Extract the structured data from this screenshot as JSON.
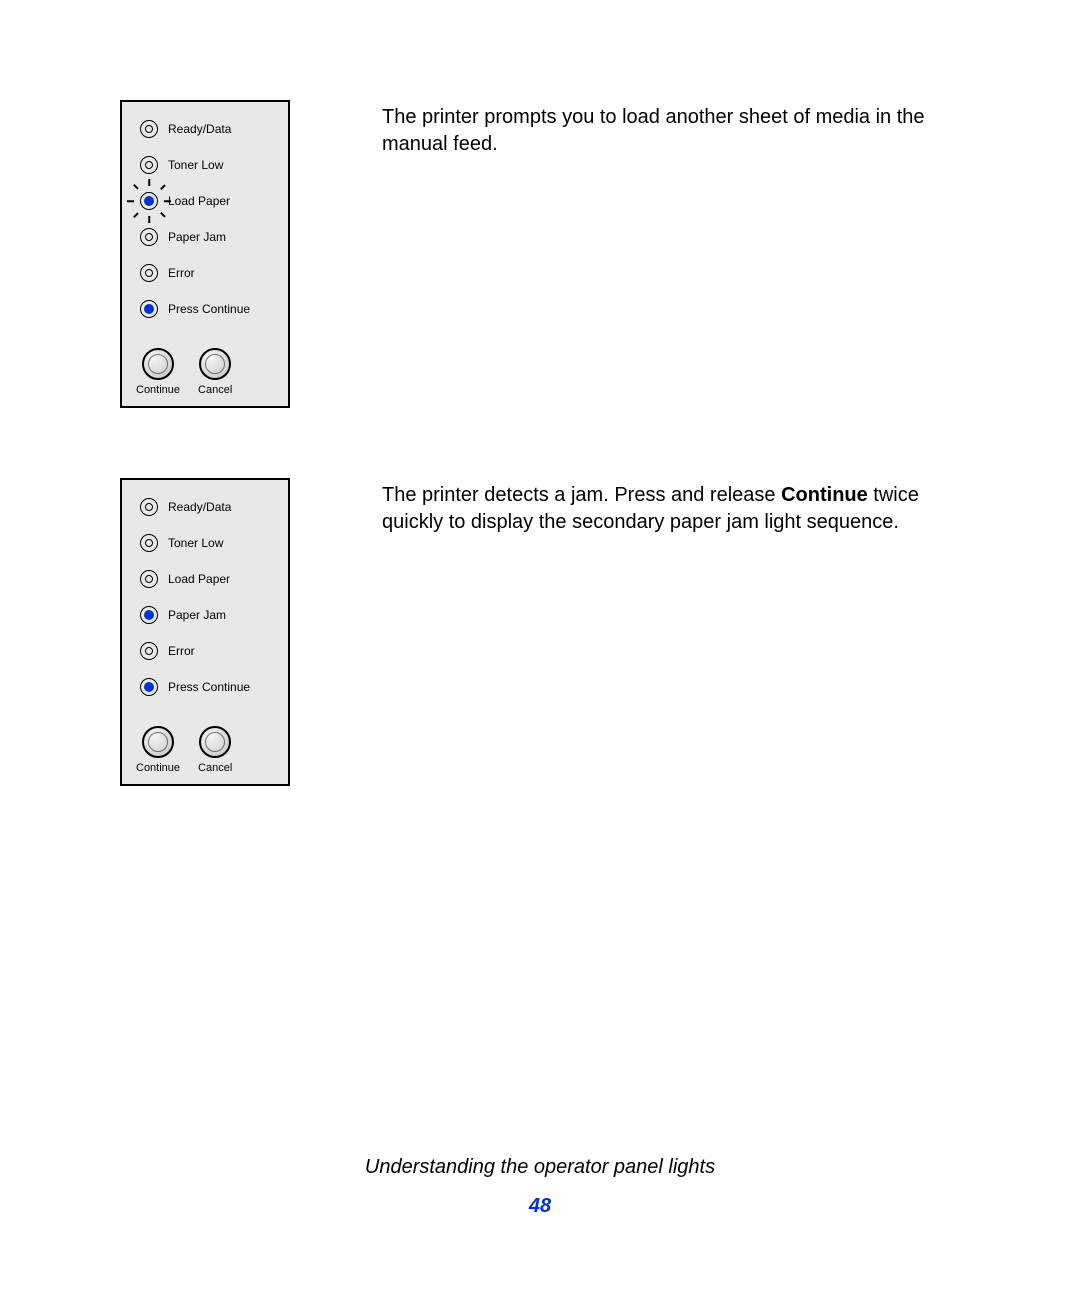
{
  "footer": {
    "title": "Understanding the operator panel lights",
    "page_number": "48"
  },
  "sections": [
    {
      "description_parts": [
        "The printer prompts you to load another sheet of media in the manual feed."
      ],
      "panel": {
        "lights": [
          {
            "label": "Ready/Data",
            "state": "off"
          },
          {
            "label": "Toner Low",
            "state": "off"
          },
          {
            "label": "Load Paper",
            "state": "blink"
          },
          {
            "label": "Paper Jam",
            "state": "off"
          },
          {
            "label": "Error",
            "state": "off"
          },
          {
            "label": "Press Continue",
            "state": "on"
          }
        ],
        "buttons": [
          {
            "label": "Continue"
          },
          {
            "label": "Cancel"
          }
        ]
      }
    },
    {
      "description_parts": [
        "The printer detects a jam. Press and release ",
        "Continue",
        " twice quickly to display the secondary paper jam light sequence."
      ],
      "panel": {
        "lights": [
          {
            "label": "Ready/Data",
            "state": "off"
          },
          {
            "label": "Toner Low",
            "state": "off"
          },
          {
            "label": "Load Paper",
            "state": "off"
          },
          {
            "label": "Paper Jam",
            "state": "on"
          },
          {
            "label": "Error",
            "state": "off"
          },
          {
            "label": "Press Continue",
            "state": "on"
          }
        ],
        "buttons": [
          {
            "label": "Continue"
          },
          {
            "label": "Cancel"
          }
        ]
      }
    }
  ]
}
